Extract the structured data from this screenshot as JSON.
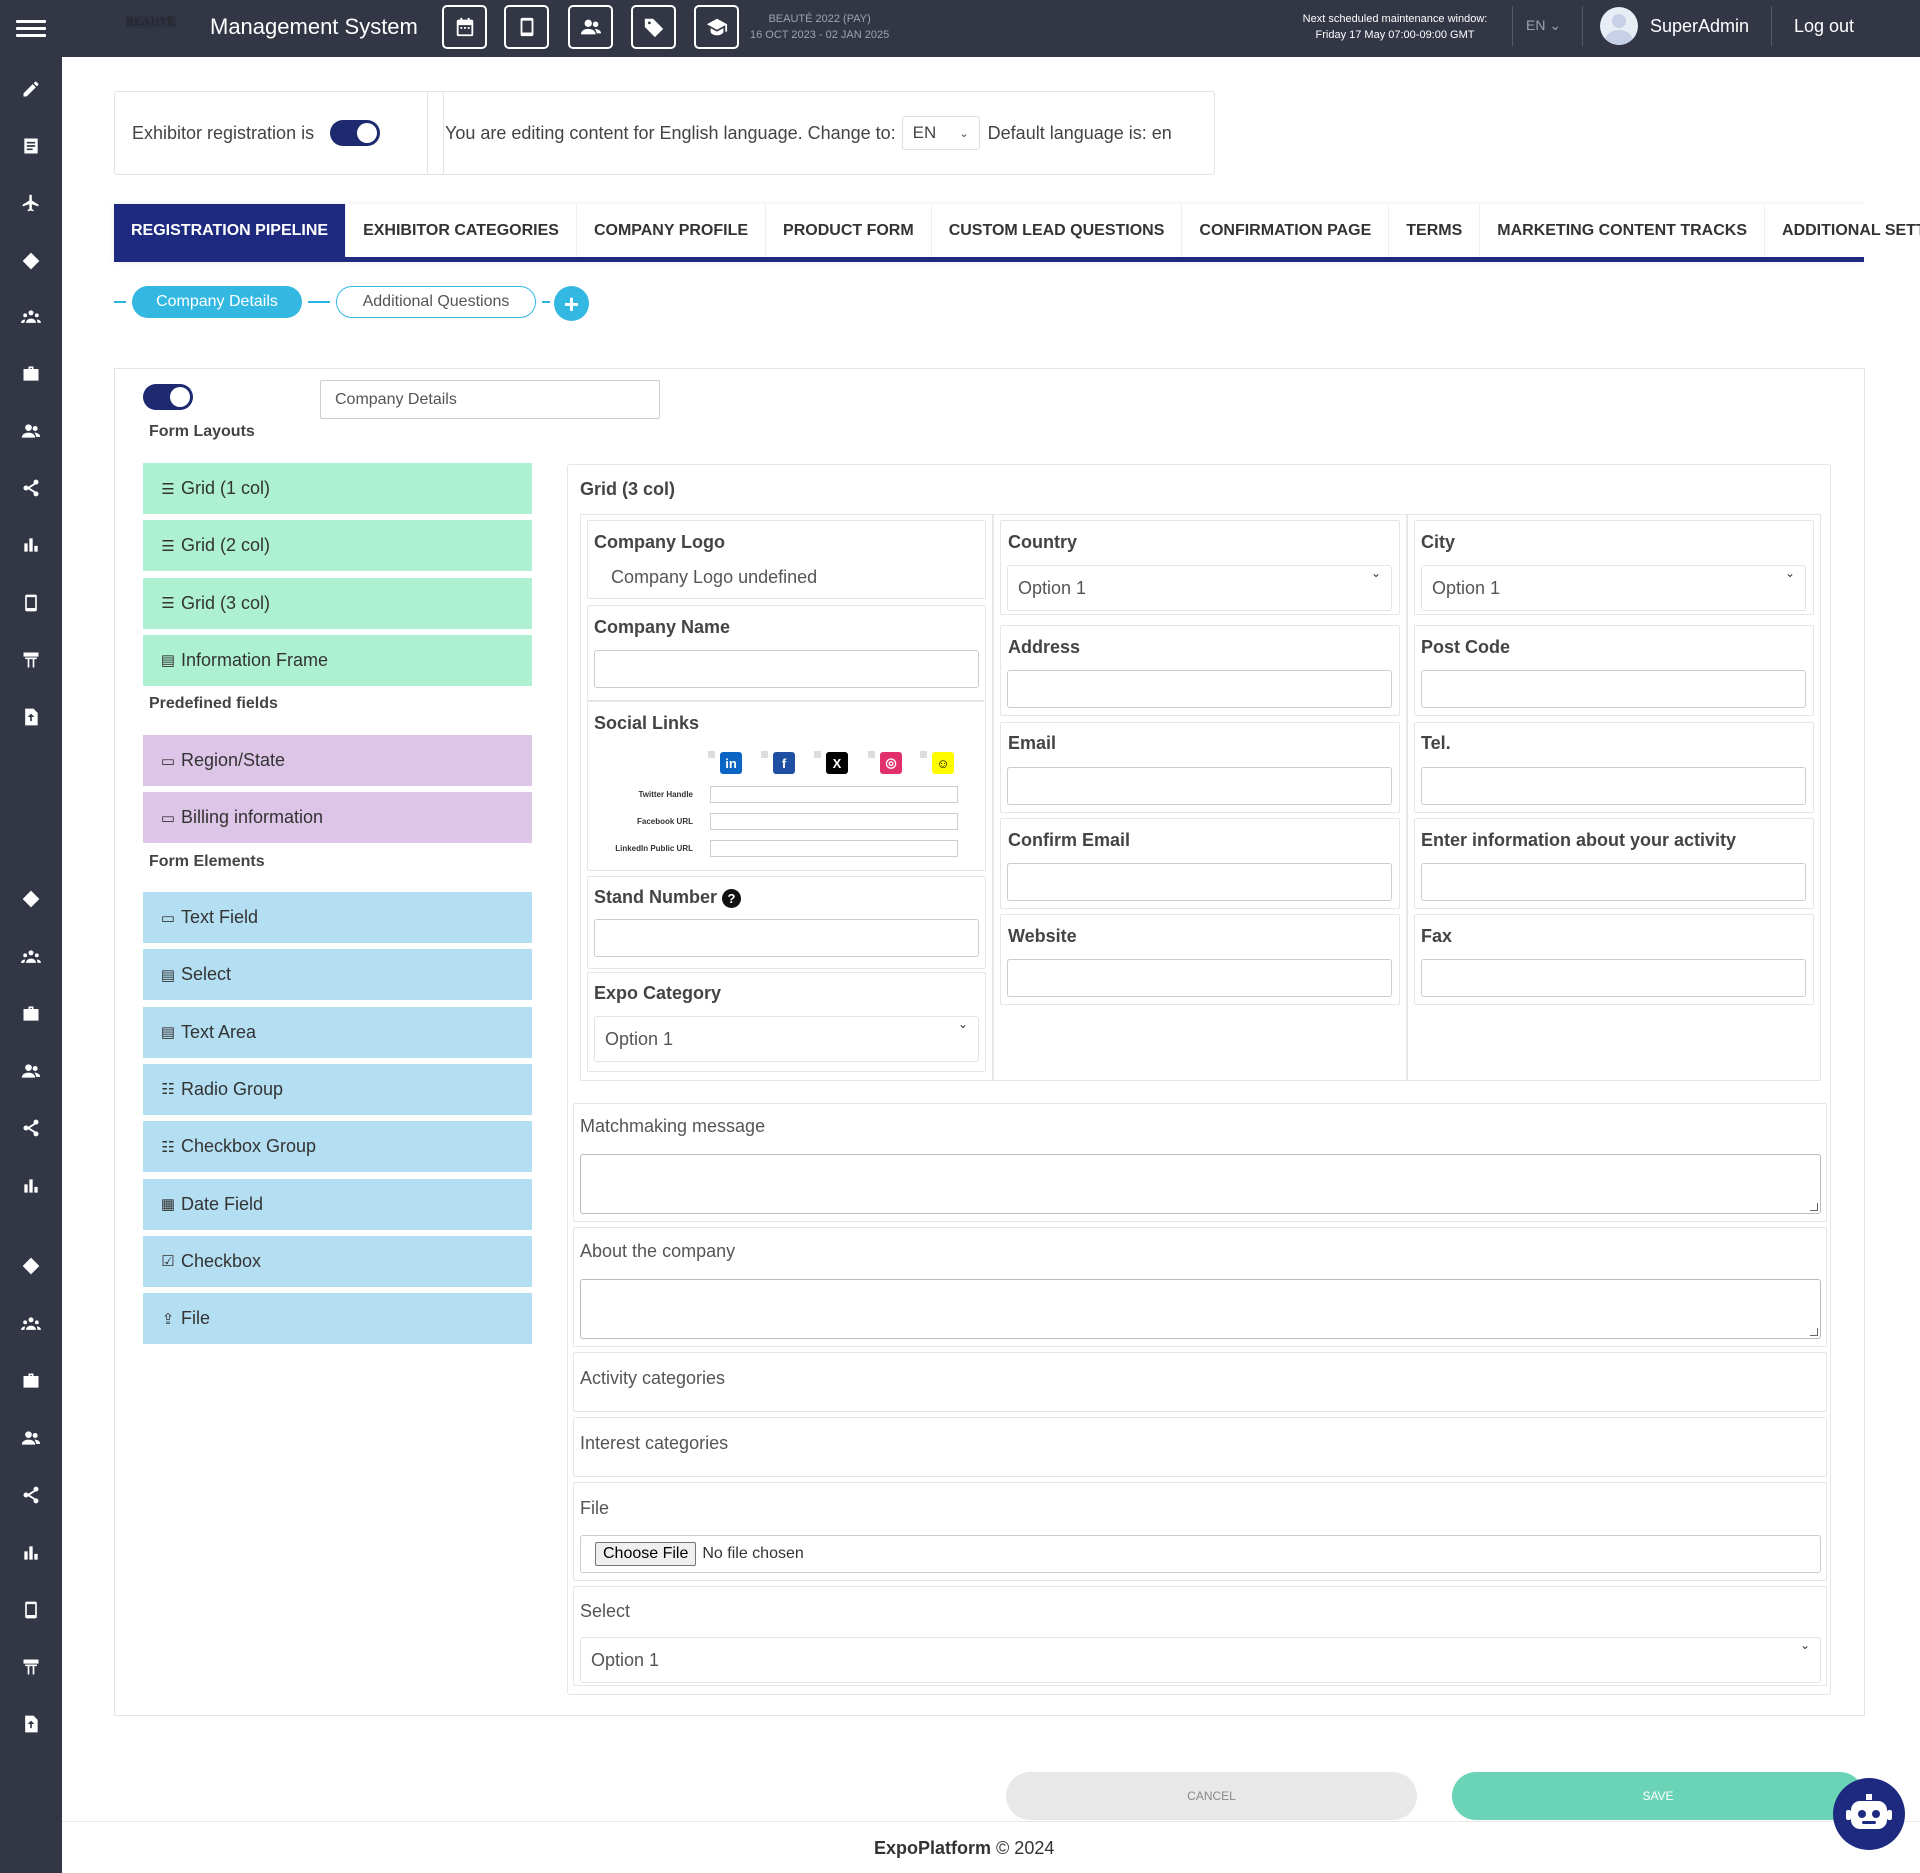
{
  "header": {
    "logo_text": "BEAUTÉ",
    "app_title": "Management System",
    "toolbar_icons": [
      "calendar-icon",
      "mobile-icon",
      "users-icon",
      "tag-icon",
      "graduation-cap-icon"
    ],
    "event_name": "BEAUTÉ 2022 (PAY)",
    "event_dates": "16 OCT 2023 - 02 JAN 2025",
    "maintenance_title": "Next scheduled maintenance window:",
    "maintenance_time": "Friday 17 May 07:00-09:00 GMT",
    "language": "EN",
    "user_name": "SuperAdmin",
    "logout_label": "Log out"
  },
  "sidebar": {
    "icons": [
      "pencil-icon",
      "document-icon",
      "plane-icon",
      "tag-icon",
      "group-icon",
      "briefcase-icon",
      "users-icon",
      "share-icon",
      "chart-icon",
      "mobile-icon",
      "booth-icon",
      "upload-file-icon",
      "tag-icon",
      "group-icon",
      "briefcase-icon",
      "users-icon",
      "share-icon",
      "chart-icon",
      "tag-icon",
      "group-icon",
      "briefcase-icon",
      "users-icon",
      "share-icon",
      "chart-icon",
      "mobile-icon",
      "booth-icon",
      "upload-file-icon"
    ]
  },
  "settings": {
    "registration_label": "Exhibitor registration is",
    "registration_enabled": true,
    "editing_text": "You are editing content for English language. Change to:",
    "language_value": "EN",
    "default_language_text": "Default language is: en"
  },
  "tabs": [
    {
      "label": "REGISTRATION PIPELINE",
      "active": true
    },
    {
      "label": "EXHIBITOR CATEGORIES"
    },
    {
      "label": "COMPANY PROFILE"
    },
    {
      "label": "PRODUCT FORM"
    },
    {
      "label": "CUSTOM LEAD QUESTIONS"
    },
    {
      "label": "CONFIRMATION PAGE"
    },
    {
      "label": "TERMS"
    },
    {
      "label": "MARKETING CONTENT TRACKS"
    },
    {
      "label": "ADDITIONAL SETTI"
    }
  ],
  "pipeline": {
    "steps": [
      "Company Details",
      "Additional Questions"
    ],
    "add_label": "+"
  },
  "builder": {
    "page_name": "Company Details",
    "page_enabled": true,
    "sections": {
      "layouts": "Form Layouts",
      "predefined": "Predefined fields",
      "elements": "Form Elements"
    },
    "layouts": [
      {
        "label": "Grid (1 col)",
        "icon": "list-icon",
        "glyph": "☰"
      },
      {
        "label": "Grid (2 col)",
        "icon": "list-icon",
        "glyph": "☰"
      },
      {
        "label": "Grid (3 col)",
        "icon": "list-icon",
        "glyph": "☰"
      },
      {
        "label": "Information Frame",
        "icon": "frame-icon",
        "glyph": "▤"
      }
    ],
    "predefined": [
      {
        "label": "Region/State",
        "icon": "field-icon",
        "glyph": "▭"
      },
      {
        "label": "Billing information",
        "icon": "field-icon",
        "glyph": "▭"
      }
    ],
    "elements": [
      {
        "label": "Text Field",
        "icon": "text-field-icon",
        "glyph": "▭"
      },
      {
        "label": "Select",
        "icon": "select-icon",
        "glyph": "▤"
      },
      {
        "label": "Text Area",
        "icon": "textarea-icon",
        "glyph": "▤"
      },
      {
        "label": "Radio Group",
        "icon": "radio-group-icon",
        "glyph": "☷"
      },
      {
        "label": "Checkbox Group",
        "icon": "checkbox-group-icon",
        "glyph": "☷"
      },
      {
        "label": "Date Field",
        "icon": "calendar-icon",
        "glyph": "▦"
      },
      {
        "label": "Checkbox",
        "icon": "checkbox-icon",
        "glyph": "☑"
      },
      {
        "label": "File",
        "icon": "upload-icon",
        "glyph": "⇪"
      }
    ]
  },
  "form": {
    "grid_title": "Grid (3 col)",
    "company_logo_label": "Company Logo",
    "company_logo_value": "Company Logo undefined",
    "company_name_label": "Company Name",
    "social_links_label": "Social Links",
    "social_icons": [
      {
        "name": "linkedin-icon",
        "glyph": "in",
        "color": "#0a66c2"
      },
      {
        "name": "facebook-icon",
        "glyph": "f",
        "color": "#1f4fa3"
      },
      {
        "name": "x-icon",
        "glyph": "X",
        "color": "#000000"
      },
      {
        "name": "instagram-icon",
        "glyph": "◎",
        "color": "#e1306c"
      },
      {
        "name": "snapchat-icon",
        "glyph": "☺",
        "color": "#fffc00"
      }
    ],
    "social_fields": [
      "Twitter Handle",
      "Facebook URL",
      "LinkedIn Public URL"
    ],
    "stand_number_label": "Stand Number",
    "help_glyph": "?",
    "expo_category_label": "Expo Category",
    "expo_category_value": "Option 1",
    "country_label": "Country",
    "country_value": "Option 1",
    "address_label": "Address",
    "email_label": "Email",
    "confirm_email_label": "Confirm Email",
    "website_label": "Website",
    "city_label": "City",
    "city_value": "Option 1",
    "post_code_label": "Post Code",
    "tel_label": "Tel.",
    "activity_info_label": "Enter information about your activity",
    "fax_label": "Fax",
    "matchmaking_label": "Matchmaking message",
    "about_label": "About the company",
    "activity_categories_label": "Activity categories",
    "interest_categories_label": "Interest categories",
    "file_label": "File",
    "choose_file_label": "Choose File",
    "no_file_label": "No file chosen",
    "select_label": "Select",
    "select_value": "Option 1"
  },
  "footer": {
    "cancel_label": "CANCEL",
    "save_label": "SAVE",
    "brand": "ExpoPlatform",
    "copyright": "© 2024"
  },
  "colors": {
    "navy": "#1e2a80",
    "topbar": "#323645",
    "accent_blue": "#33b8e1",
    "layout_green": "#adf1d2",
    "predefined_purple": "#dcc5e7",
    "element_blue": "#b4def2",
    "save_green": "#6cd4b6"
  }
}
